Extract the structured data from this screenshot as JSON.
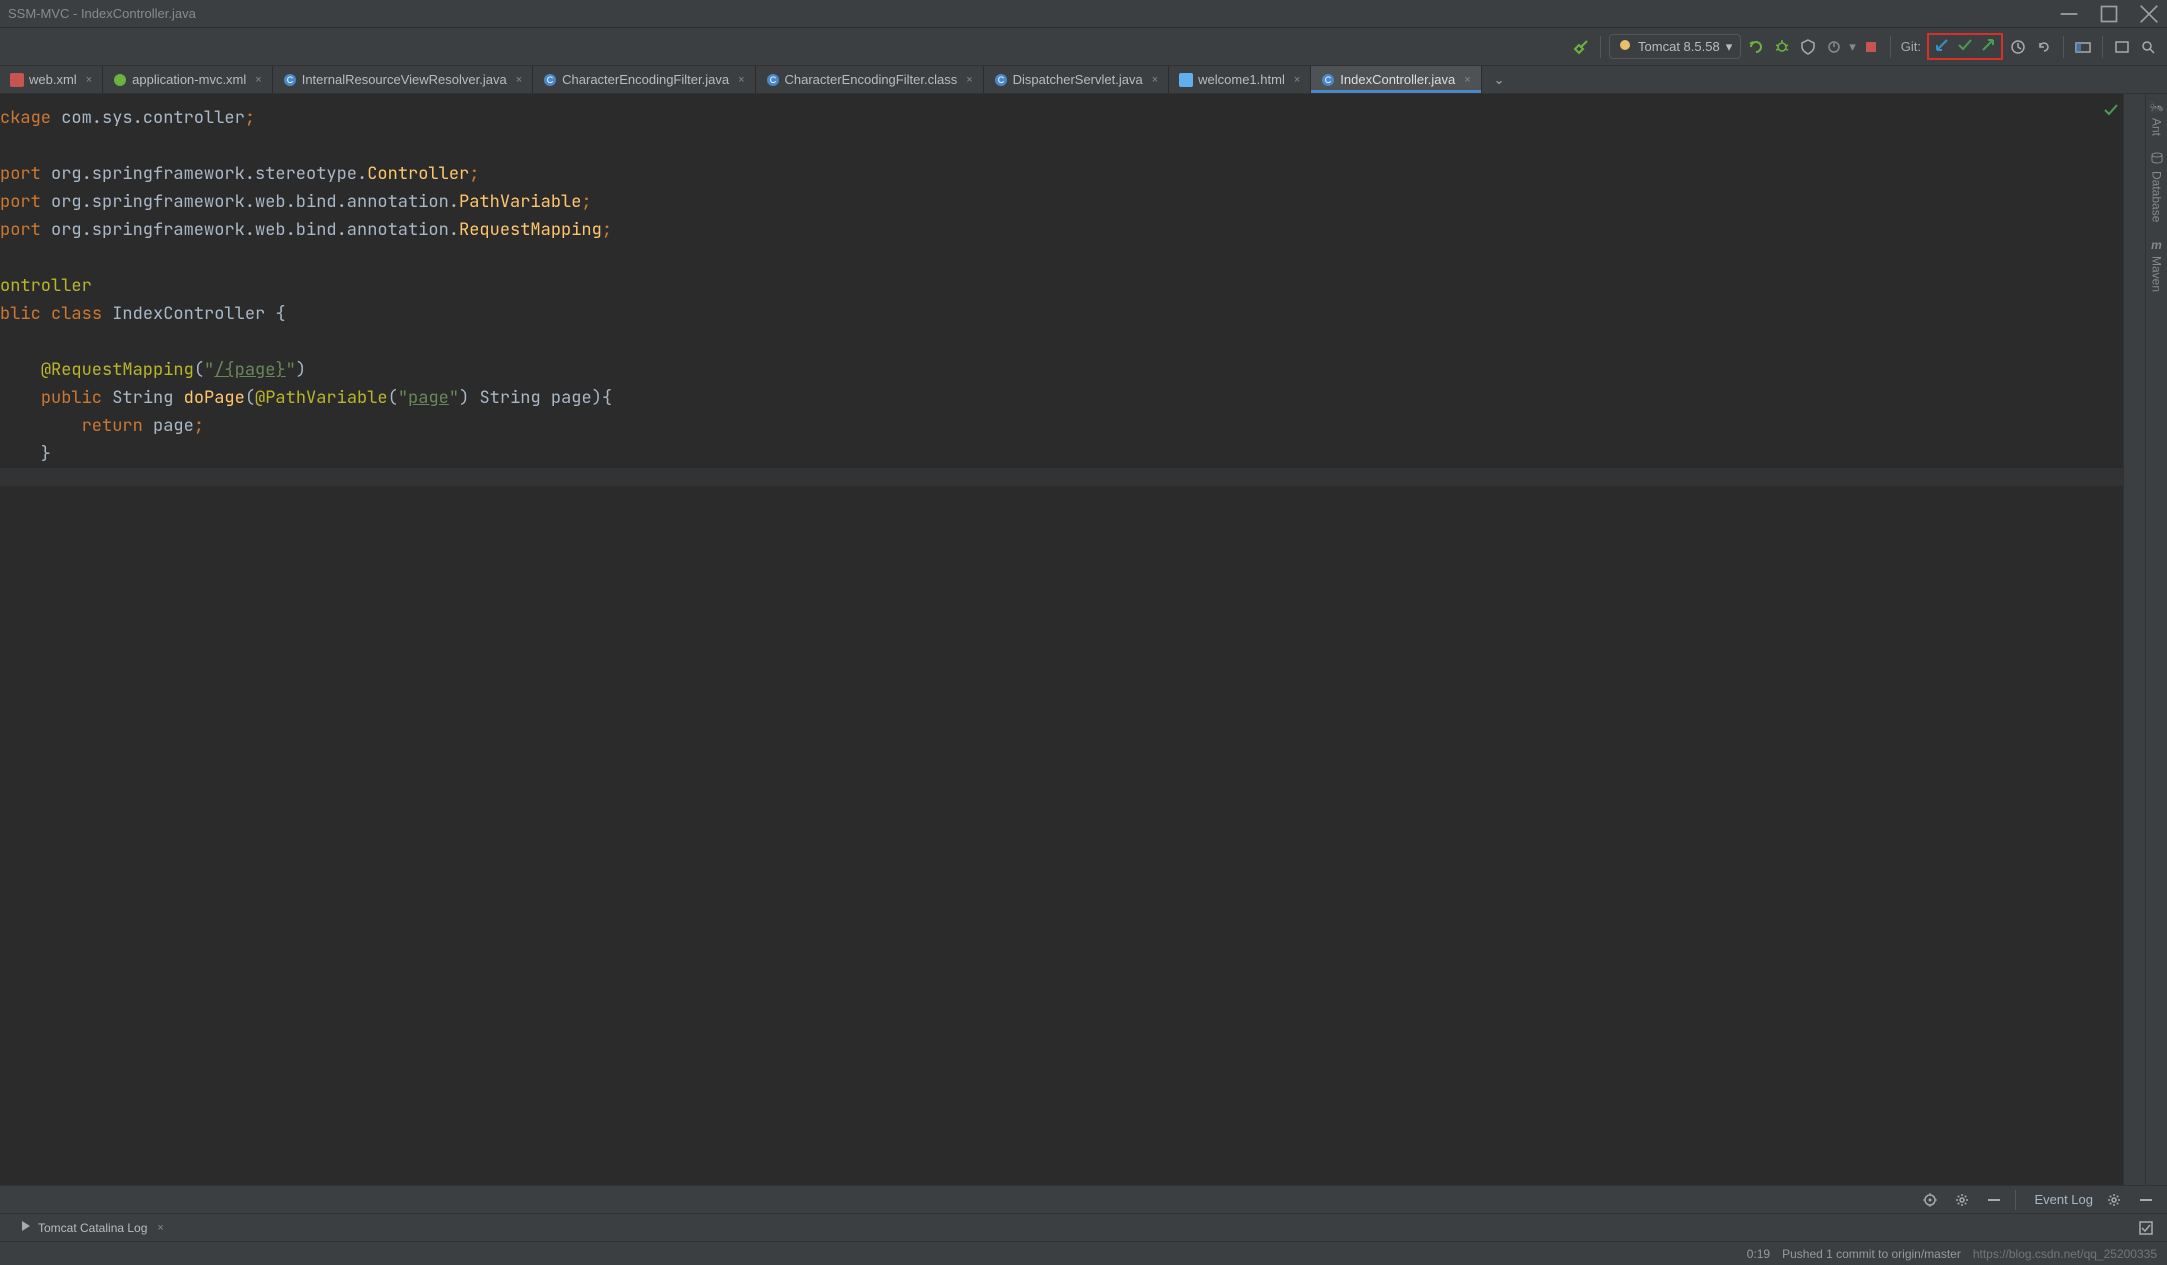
{
  "title": "SSM-MVC - IndexController.java",
  "toolbar": {
    "run_config": "Tomcat 8.5.58",
    "git_label": "Git:"
  },
  "tabs": [
    {
      "label": "web.xml",
      "icon": "xml"
    },
    {
      "label": "application-mvc.xml",
      "icon": "spring"
    },
    {
      "label": "InternalResourceViewResolver.java",
      "icon": "class"
    },
    {
      "label": "CharacterEncodingFilter.java",
      "icon": "class"
    },
    {
      "label": "CharacterEncodingFilter.class",
      "icon": "class"
    },
    {
      "label": "DispatcherServlet.java",
      "icon": "class"
    },
    {
      "label": "welcome1.html",
      "icon": "html"
    },
    {
      "label": "IndexController.java",
      "icon": "class",
      "active": true
    }
  ],
  "code": {
    "l1_kw": "ckage",
    "l1_pkg": " com.sys.controller",
    "l2_kw": "port",
    "l2_base": " org.springframework.stereotype.",
    "l2_cls": "Controller",
    "l3_kw": "port",
    "l3_base": " org.springframework.web.bind.annotation.",
    "l3_cls": "PathVariable",
    "l4_kw": "port",
    "l4_base": " org.springframework.web.bind.annotation.",
    "l4_cls": "RequestMapping",
    "l5_ann": "ontroller",
    "l6_kw1": "blic",
    "l6_kw2": "class",
    "l6_cls": "IndexController",
    "l7_ann": "@RequestMapping",
    "l7_str1": "\"",
    "l7_str2": "/{page}",
    "l7_str3": "\"",
    "l8_kw": "public",
    "l8_type": "String",
    "l8_method": "doPage",
    "l8_ann": "@PathVariable",
    "l8_str": "\"",
    "l8_param": "page",
    "l8_str2": "\"",
    "l8_type2": "String",
    "l8_pname": "page",
    "l9_kw": "return",
    "l9_var": "page"
  },
  "right_rail": [
    {
      "label": "Ant",
      "icon": "ant"
    },
    {
      "label": "Database",
      "icon": "db"
    },
    {
      "label": "Maven",
      "icon": "m"
    }
  ],
  "bottom_panel": {
    "event_log": "Event Log"
  },
  "bottom_tabs": [
    {
      "label": "Tomcat Catalina Log"
    }
  ],
  "status": {
    "cursor": "0:19",
    "message": "Pushed 1 commit to origin/master",
    "watermark": "https://blog.csdn.net/qq_25200335"
  }
}
